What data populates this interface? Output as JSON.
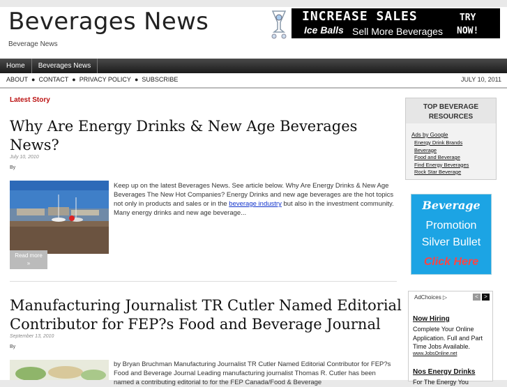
{
  "site": {
    "title": "Beverages News",
    "description": "Beverage News"
  },
  "banner": {
    "line1": "INCREASE SALES",
    "line2a": "Ice Balls",
    "line2b": "Sell More Beverages",
    "try1": "TRY",
    "try2": "NOW!"
  },
  "nav_primary": [
    "Home",
    "Beverages News"
  ],
  "nav_secondary": {
    "about": "ABOUT",
    "contact": "CONTACT",
    "privacy": "PRIVACY POLICY",
    "subscribe": "SUBSCRIBE",
    "date": "JULY 10, 2011"
  },
  "latest_label": "Latest Story",
  "posts": [
    {
      "title_line1": "Why Are Energy Drinks & New Age Beverages",
      "title_line2": "News?",
      "date": "July 10, 2010",
      "by": "By",
      "excerpt_before": "Keep up on the latest Beverages News. See article below. Why Are Energy Drinks & New Age Beverages The New Hot Companies? Energy Drinks and new age beverages are the hot topics not only in products and sales or in the ",
      "excerpt_link": "beverage industry",
      "excerpt_after": " but also in the investment community. Many energy drinks and new age beverage...",
      "read_more": "Read more",
      "read_more_arrow": "»"
    },
    {
      "title_line1": "Manufacturing Journalist TR Cutler Named Editorial",
      "title_line2": "Contributor for FEP?s Food and Beverage Journal",
      "date": "September 13, 2010",
      "by": "By",
      "excerpt": "by Bryan Bruchman Manufacturing Journalist TR Cutler Named Editorial Contributor for FEP?s Food and Beverage Journal Leading manufacturing journalist Thomas R. Cutler has been named a contributing editorial to for the FEP Canada/Food & Beverage"
    }
  ],
  "sidebar": {
    "heading_line1": "TOP BEVERAGE",
    "heading_line2": "RESOURCES",
    "ads_by": "Ads by Google",
    "ad_links": [
      "Energy Drink Brands",
      "Beverage",
      "Food and Beverage",
      "Find Energy Beverages",
      "Rock Star Beverage"
    ]
  },
  "promo": {
    "t1": "Beverage",
    "t2": "Promotion",
    "t3": "Silver Bullet",
    "t4": "Click Here"
  },
  "adchoices": {
    "label": "AdChoices ▷",
    "prev": "<",
    "next": ">",
    "ad1_title": "Now Hiring",
    "ad1_body": "Complete Your Online Application. Full and Part Time Jobs Available.",
    "ad1_url": "www.JobsOnline.net",
    "ad2_title": "Nos Energy Drinks",
    "ad2_body": "For The Energy You"
  },
  "colors": {
    "accent_red": "#bb1111",
    "promo_blue": "#1ca4e4",
    "link_blue": "#1133cc"
  }
}
